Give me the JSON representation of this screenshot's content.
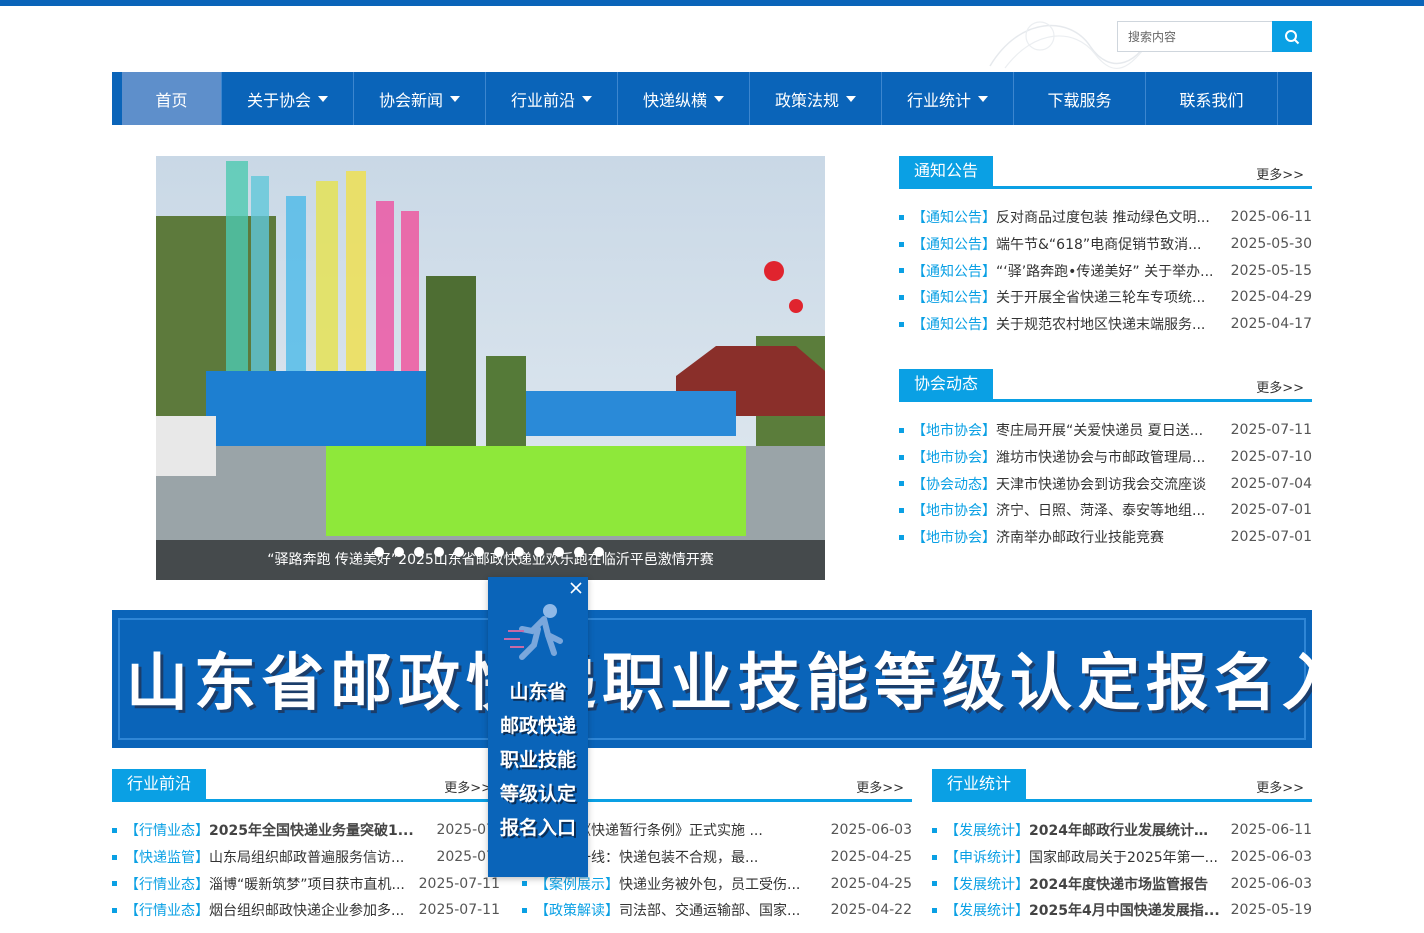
{
  "search": {
    "placeholder": "搜索内容",
    "icon": "search-icon"
  },
  "nav": [
    {
      "label": "首页",
      "dropdown": false,
      "active": true
    },
    {
      "label": "关于协会",
      "dropdown": true
    },
    {
      "label": "协会新闻",
      "dropdown": true
    },
    {
      "label": "行业前沿",
      "dropdown": true
    },
    {
      "label": "快递纵横",
      "dropdown": true
    },
    {
      "label": "政策法规",
      "dropdown": true
    },
    {
      "label": "行业统计",
      "dropdown": true
    },
    {
      "label": "下载服务",
      "dropdown": false
    },
    {
      "label": "联系我们",
      "dropdown": false
    }
  ],
  "slider": {
    "caption": "“驿路奔跑 传递美好”2025山东省邮政快递业欢乐跑在临沂平邑激情开赛",
    "dot_count": 12
  },
  "notices": {
    "title": "通知公告",
    "more": "更多>>",
    "items": [
      {
        "tag": "【通知公告】",
        "title": "反对商品过度包装 推动绿色文明...",
        "date": "2025-06-11"
      },
      {
        "tag": "【通知公告】",
        "title": "端午节&“618”电商促销节致消...",
        "date": "2025-05-30"
      },
      {
        "tag": "【通知公告】",
        "title": "“‘驿’路奔跑•传递美好” 关于举办...",
        "date": "2025-05-15"
      },
      {
        "tag": "【通知公告】",
        "title": " 关于开展全省快递三轮车专项统...",
        "date": "2025-04-29"
      },
      {
        "tag": "【通知公告】",
        "title": "关于规范农村地区快递末端服务...",
        "date": "2025-04-17"
      }
    ]
  },
  "dynamics": {
    "title": "协会动态",
    "more": "更多>>",
    "items": [
      {
        "tag": "【地市协会】",
        "title": "枣庄局开展“关爱快递员 夏日送...",
        "date": "2025-07-11"
      },
      {
        "tag": "【地市协会】",
        "title": "潍坊市快递协会与市邮政管理局...",
        "date": "2025-07-10"
      },
      {
        "tag": "【协会动态】",
        "title": "天津市快递协会到访我会交流座谈",
        "date": "2025-07-04"
      },
      {
        "tag": "【地市协会】",
        "title": "济宁、日照、菏泽、泰安等地组...",
        "date": "2025-07-01"
      },
      {
        "tag": "【地市协会】",
        "title": "济南举办邮政行业技能竞赛",
        "date": "2025-07-01"
      }
    ]
  },
  "banner": {
    "text": "山东省邮政快递职业技能等级认定报名入口"
  },
  "float_ad": {
    "lines": [
      "山东省",
      "邮政快递",
      "职业技能",
      "等级认定",
      "报名入口"
    ],
    "close_icon": "close-icon"
  },
  "frontier": {
    "title": "行业前沿",
    "more": "更多>>",
    "items": [
      {
        "tag": "【行情业态】",
        "title": "2025年全国快递业务量突破1...",
        "date": "2025-07-",
        "bold": true
      },
      {
        "tag": "【快递监管】",
        "title": "山东局组织邮政普遍服务信访...",
        "date": "2025-07-",
        "bold": false
      },
      {
        "tag": "【行情业态】",
        "title": "淄博“暖新筑梦”项目获市直机...",
        "date": "2025-07-11",
        "bold": false
      },
      {
        "tag": "【行情业态】",
        "title": "烟台组织邮政快递企业参加多...",
        "date": "2025-07-11",
        "bold": false
      }
    ]
  },
  "policy": {
    "title": "法规",
    "more": "更多>>",
    "items": [
      {
        "tag": "解读】",
        "title": "《快递暂行条例》正式实施 ...",
        "date": "2025-06-03"
      },
      {
        "tag": "展示】",
        "title": "一线：快递包装不合规，最...",
        "date": "2025-04-25"
      },
      {
        "tag": "【案例展示】",
        "title": "快递业务被外包，员工受伤...",
        "date": "2025-04-25"
      },
      {
        "tag": "【政策解读】",
        "title": "司法部、交通运输部、国家...",
        "date": "2025-04-22"
      }
    ]
  },
  "stats": {
    "title": "行业统计",
    "more": "更多>>",
    "items": [
      {
        "tag": "【发展统计】",
        "title": "2024年邮政行业发展统计公报",
        "date": "2025-06-11",
        "bold": true
      },
      {
        "tag": "【申诉统计】",
        "title": "国家邮政局关于2025年第一...",
        "date": "2025-06-03",
        "bold": false
      },
      {
        "tag": "【发展统计】",
        "title": "2024年度快递市场监管报告",
        "date": "2025-06-03",
        "bold": true
      },
      {
        "tag": "【发展统计】",
        "title": "2025年4月中国快递发展指...",
        "date": "2025-05-19",
        "bold": true
      }
    ]
  }
}
